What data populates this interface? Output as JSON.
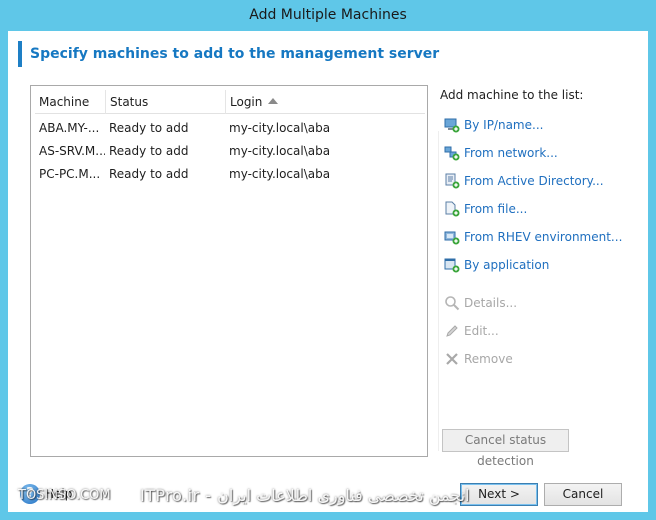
{
  "window": {
    "title": "Add Multiple Machines"
  },
  "heading": "Specify machines to add to the management server",
  "list": {
    "columns": [
      "Machine",
      "Status",
      "Login"
    ],
    "sort_column": "Login",
    "rows": [
      {
        "machine": "ABA.MY-...",
        "status": "Ready to add",
        "login": "my-city.local\\aba"
      },
      {
        "machine": "AS-SRV.M...",
        "status": "Ready to add",
        "login": "my-city.local\\aba"
      },
      {
        "machine": "PC-PC.M...",
        "status": "Ready to add",
        "login": "my-city.local\\aba"
      }
    ]
  },
  "side": {
    "title": "Add machine to the list:",
    "actions": [
      {
        "label": "By IP/name...",
        "icon": "computer-add-icon",
        "enabled": true
      },
      {
        "label": "From network...",
        "icon": "network-add-icon",
        "enabled": true
      },
      {
        "label": "From Active Directory...",
        "icon": "directory-add-icon",
        "enabled": true
      },
      {
        "label": "From file...",
        "icon": "file-add-icon",
        "enabled": true
      },
      {
        "label": "From RHEV environment...",
        "icon": "rhev-add-icon",
        "enabled": true
      },
      {
        "label": "By application",
        "icon": "application-add-icon",
        "enabled": true
      },
      {
        "label": "Details...",
        "icon": "magnifier-icon",
        "enabled": false
      },
      {
        "label": "Edit...",
        "icon": "pencil-icon",
        "enabled": false
      },
      {
        "label": "Remove",
        "icon": "remove-x-icon",
        "enabled": false
      }
    ],
    "cancel_detection": "Cancel status detection"
  },
  "footer": {
    "help": "Help",
    "next": "Next >",
    "cancel": "Cancel"
  },
  "watermark": {
    "left": "TOSINSO.COM",
    "right": "ITPro.ir - انجمن تخصصی فناوری اطلاعات ایران"
  },
  "colors": {
    "window_frame": "#5fc7e8",
    "accent": "#1678c2",
    "link": "#1f6fbf",
    "disabled": "#a7a7a7"
  }
}
